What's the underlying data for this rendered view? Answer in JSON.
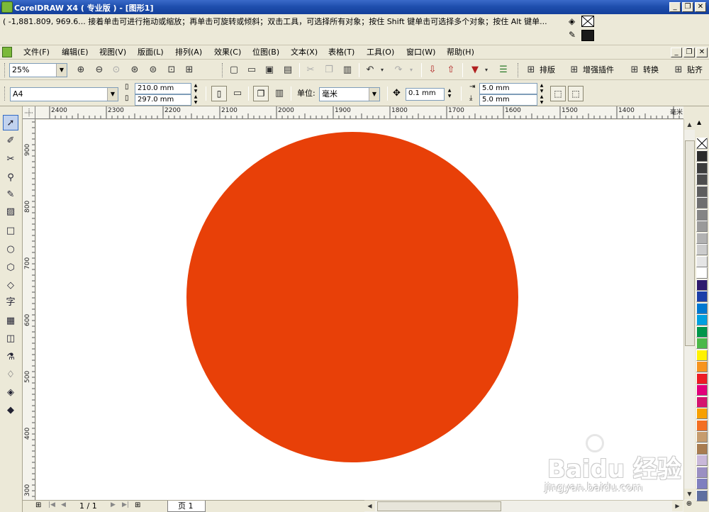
{
  "window": {
    "title": "CorelDRAW X4 ( 专业版 ) - [图形1]",
    "controls": {
      "minimize": "_",
      "restore": "❐",
      "close": "✕"
    }
  },
  "hint": {
    "text": "( -1,881.809, 969.6...  接着单击可进行拖动或缩放；再单击可旋转或倾斜；双击工具，可选择所有对象；按住 Shift 键单击可选择多个对象；按住 Alt 键单..."
  },
  "menu": {
    "items": [
      "文件(F)",
      "编辑(E)",
      "视图(V)",
      "版面(L)",
      "排列(A)",
      "效果(C)",
      "位图(B)",
      "文本(X)",
      "表格(T)",
      "工具(O)",
      "窗口(W)",
      "帮助(H)"
    ]
  },
  "toolbar": {
    "zoom_value": "25%",
    "buttons": {
      "paiban": "排版",
      "plugins": "增强插件",
      "convert": "转换",
      "snap": "贴齐"
    }
  },
  "property_bar": {
    "paper_size": "A4",
    "width": "210.0 mm",
    "height": "297.0 mm",
    "units_label": "单位:",
    "units_value": "毫米",
    "nudge": "0.1 mm",
    "dup_x": "5.0 mm",
    "dup_y": "5.0 mm"
  },
  "ruler": {
    "h_labels": [
      "2400",
      "2300",
      "2200",
      "2100",
      "2000",
      "1900",
      "1800",
      "1700",
      "1600",
      "1500",
      "1400"
    ],
    "h_unit": "毫米",
    "v_labels": [
      "900",
      "800",
      "700",
      "600",
      "500",
      "400",
      "300"
    ],
    "v_unit": "毫米"
  },
  "canvas": {
    "shape": "circle",
    "fill_color": "#e84008"
  },
  "palette": {
    "colors": [
      "#2b2b2b",
      "#3d3d3d",
      "#4d4d4d",
      "#5e5e5e",
      "#6f6f6f",
      "#858585",
      "#9a9a9a",
      "#b2b2b2",
      "#cccccc",
      "#e5e5e5",
      "#ffffff",
      "#2e1a6e",
      "#1c3fa8",
      "#0078d0",
      "#00a0e0",
      "#00964a",
      "#4cb848",
      "#fff200",
      "#f7941d",
      "#ed1c24",
      "#e2007a",
      "#d4146e",
      "#f7a000",
      "#f36f21",
      "#c69c6d",
      "#a87c4f",
      "#c9b8d9",
      "#9a8fc2",
      "#7f7fbf",
      "#5f6fa0"
    ]
  },
  "pagenav": {
    "page_count": "1 / 1",
    "page_tab": "页 1"
  },
  "watermark": {
    "brand": "Baidu 经验",
    "url": "jingyan.baidu.com"
  }
}
